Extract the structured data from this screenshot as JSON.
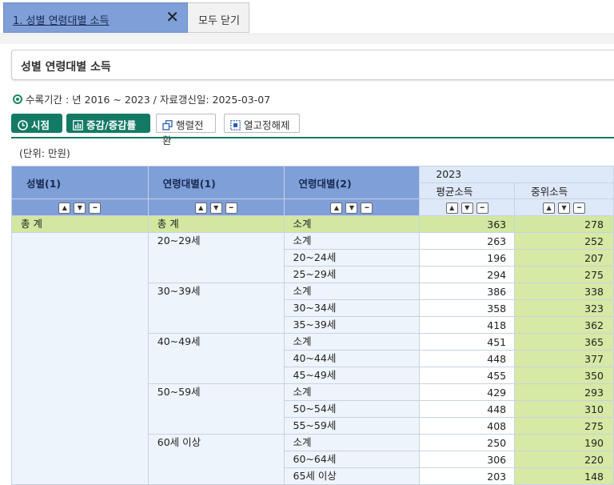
{
  "tabs": {
    "active_label": "1. 성별 연령대별 소득",
    "close_all_label": "모두 닫기"
  },
  "page_title": "성별 연령대별 소득",
  "period_text": "수록기간 : 년 2016 ~ 2023 / 자료갱신일: 2025-03-07",
  "toolbar": {
    "time_label": "시점",
    "change_label": "증감/증감률",
    "transpose_label": "행렬전환",
    "unfix_label": "열고정해제"
  },
  "unit_text": "(단위: 만원)",
  "table": {
    "headers": {
      "gender": "성별(1)",
      "age1": "연령대별(1)",
      "age2": "연령대별(2)",
      "year": "2023",
      "avg": "평균소득",
      "median": "중위소득"
    },
    "rows": [
      {
        "g": "총 계",
        "a1": "총 계",
        "a2": "소계",
        "avg": "363",
        "med": "278"
      },
      {
        "g": "",
        "a1": "20~29세",
        "a2": "소계",
        "avg": "263",
        "med": "252"
      },
      {
        "g": "",
        "a1": "",
        "a2": "20~24세",
        "avg": "196",
        "med": "207"
      },
      {
        "g": "",
        "a1": "",
        "a2": "25~29세",
        "avg": "294",
        "med": "275"
      },
      {
        "g": "",
        "a1": "30~39세",
        "a2": "소계",
        "avg": "386",
        "med": "338"
      },
      {
        "g": "",
        "a1": "",
        "a2": "30~34세",
        "avg": "358",
        "med": "323"
      },
      {
        "g": "",
        "a1": "",
        "a2": "35~39세",
        "avg": "418",
        "med": "362"
      },
      {
        "g": "",
        "a1": "40~49세",
        "a2": "소계",
        "avg": "451",
        "med": "365"
      },
      {
        "g": "",
        "a1": "",
        "a2": "40~44세",
        "avg": "448",
        "med": "377"
      },
      {
        "g": "",
        "a1": "",
        "a2": "45~49세",
        "avg": "455",
        "med": "350"
      },
      {
        "g": "",
        "a1": "50~59세",
        "a2": "소계",
        "avg": "429",
        "med": "293"
      },
      {
        "g": "",
        "a1": "",
        "a2": "50~54세",
        "avg": "448",
        "med": "310"
      },
      {
        "g": "",
        "a1": "",
        "a2": "55~59세",
        "avg": "408",
        "med": "275"
      },
      {
        "g": "",
        "a1": "60세 이상",
        "a2": "소계",
        "avg": "250",
        "med": "190"
      },
      {
        "g": "",
        "a1": "",
        "a2": "60~64세",
        "avg": "306",
        "med": "220"
      },
      {
        "g": "",
        "a1": "",
        "a2": "65세 이상",
        "avg": "203",
        "med": "148"
      }
    ]
  },
  "colors": {
    "header_blue": "#7f9fd9",
    "accent_green": "#137a66",
    "total_row": "#d2e7a0",
    "median_col": "#d6e9a5"
  }
}
